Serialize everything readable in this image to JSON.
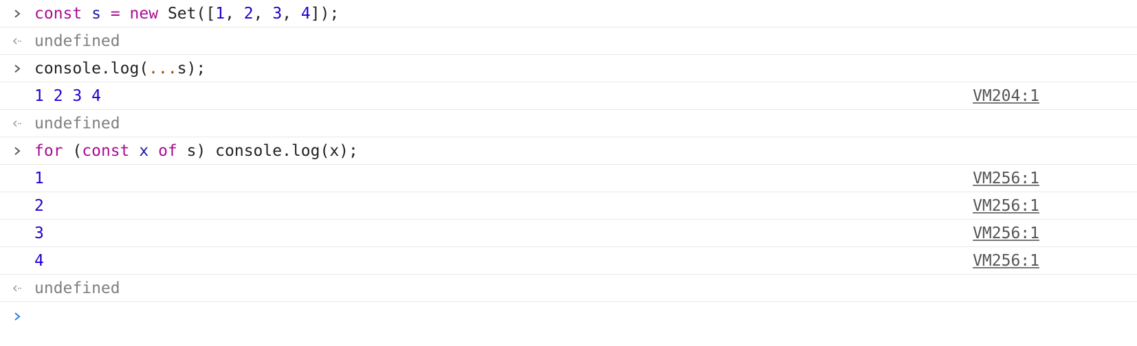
{
  "console": {
    "entries": [
      {
        "kind": "input",
        "tokens": [
          "const",
          " ",
          "s",
          " ",
          "=",
          " ",
          "new",
          " ",
          "Set",
          "([",
          "1",
          ", ",
          "2",
          ", ",
          "3",
          ", ",
          "4",
          "]);"
        ]
      },
      {
        "kind": "result",
        "text": "undefined"
      },
      {
        "kind": "input",
        "tokens": [
          "console.log(",
          "...",
          "s);"
        ]
      },
      {
        "kind": "log",
        "text": "1 2 3 4",
        "source": "VM204:1"
      },
      {
        "kind": "result",
        "text": "undefined"
      },
      {
        "kind": "input",
        "tokens": [
          "for",
          " (",
          "const",
          " ",
          "x",
          " ",
          "of",
          " s) console.log(x);"
        ]
      },
      {
        "kind": "log",
        "text": "1",
        "source": "VM256:1"
      },
      {
        "kind": "log",
        "text": "2",
        "source": "VM256:1"
      },
      {
        "kind": "log",
        "text": "3",
        "source": "VM256:1"
      },
      {
        "kind": "log",
        "text": "4",
        "source": "VM256:1"
      },
      {
        "kind": "result",
        "text": "undefined"
      }
    ],
    "prompt_value": "",
    "colors": {
      "keyword": "#aa0d91",
      "number": "#1c00cf",
      "spread": "#994500",
      "muted": "#808080",
      "prompt_active": "#2a7de1",
      "chevron": "#5a5a5a"
    },
    "icons": {
      "input_marker": "chevron-right-icon",
      "result_marker": "return-arrow-icon",
      "prompt_marker": "chevron-right-icon"
    }
  }
}
